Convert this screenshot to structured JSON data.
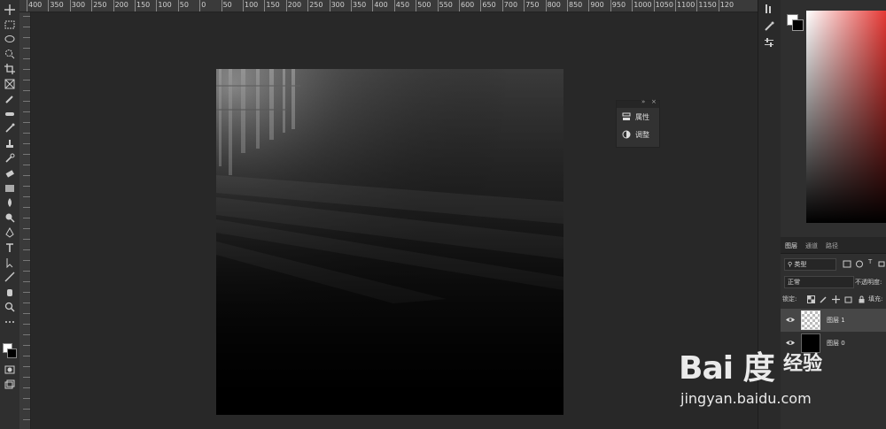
{
  "ruler": {
    "marks": [
      "400",
      "350",
      "300",
      "250",
      "200",
      "150",
      "100",
      "50",
      "0",
      "50",
      "100",
      "150",
      "200",
      "250",
      "300",
      "350",
      "400",
      "450",
      "500",
      "550",
      "600",
      "650",
      "700",
      "750",
      "800",
      "850",
      "900",
      "950",
      "1000",
      "1050",
      "1100",
      "1150",
      "120"
    ]
  },
  "canvas": {
    "description": "light rays through window on dark floor"
  },
  "float_panel": {
    "items": [
      {
        "label": "属性",
        "icon": "properties-icon"
      },
      {
        "label": "调整",
        "icon": "adjustments-icon"
      }
    ]
  },
  "layers_panel": {
    "tabs": [
      {
        "label": "图层",
        "active": true
      },
      {
        "label": "通道",
        "active": false
      },
      {
        "label": "路径",
        "active": false
      }
    ],
    "filter_label": "类型",
    "blend_mode": "正常",
    "opacity_label": "不透明度:",
    "lock_label": "锁定:",
    "fill_label": "填充:",
    "layers": [
      {
        "name": "图层 1",
        "selected": true,
        "thumb": "transparent"
      },
      {
        "name": "图层 0",
        "selected": false,
        "thumb": "black"
      }
    ]
  },
  "watermark": {
    "logo": "Bai 度",
    "text": "经验",
    "url": "jingyan.baidu.com"
  },
  "colors": {
    "workspace": "#282828",
    "panel": "#2f2f2f",
    "selected_layer": "#474747",
    "hue_red": "#e53935"
  }
}
